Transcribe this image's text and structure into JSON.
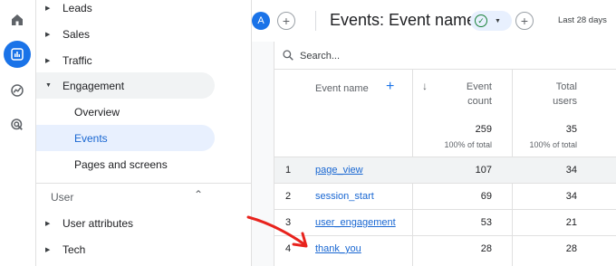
{
  "rail": {
    "items": [
      {
        "icon": "home-icon",
        "active": false
      },
      {
        "icon": "reports-icon",
        "active": true
      },
      {
        "icon": "explore-icon",
        "active": false
      },
      {
        "icon": "advertising-icon",
        "active": false
      }
    ]
  },
  "nav": {
    "items": [
      {
        "label": "Leads"
      },
      {
        "label": "Sales"
      },
      {
        "label": "Traffic"
      },
      {
        "label": "Engagement"
      }
    ],
    "sub_items": [
      {
        "label": "Overview"
      },
      {
        "label": "Events"
      },
      {
        "label": "Pages and screens"
      }
    ],
    "section_label": "User",
    "section_items": [
      {
        "label": "User attributes"
      },
      {
        "label": "Tech"
      }
    ]
  },
  "header": {
    "avatar_letter": "A",
    "title": "Events: Event name",
    "date_range": "Last 28 days"
  },
  "search": {
    "placeholder": "Search..."
  },
  "table": {
    "columns": {
      "dimension": "Event name",
      "metric1_line1": "Event",
      "metric1_line2": "count",
      "metric2_line1": "Total",
      "metric2_line2": "users"
    },
    "totals": {
      "event_count": "259",
      "event_count_pct": "100% of total",
      "total_users": "35",
      "total_users_pct": "100% of total"
    },
    "rows": [
      {
        "rank": "1",
        "name": "page_view",
        "event_count": "107",
        "total_users": "34"
      },
      {
        "rank": "2",
        "name": "session_start",
        "event_count": "69",
        "total_users": "34"
      },
      {
        "rank": "3",
        "name": "user_engagement",
        "event_count": "53",
        "total_users": "21"
      },
      {
        "rank": "4",
        "name": "thank_you",
        "event_count": "28",
        "total_users": "28"
      }
    ]
  },
  "colors": {
    "accent": "#1a73e8",
    "link": "#1967d2",
    "annotation": "#e8231d"
  }
}
